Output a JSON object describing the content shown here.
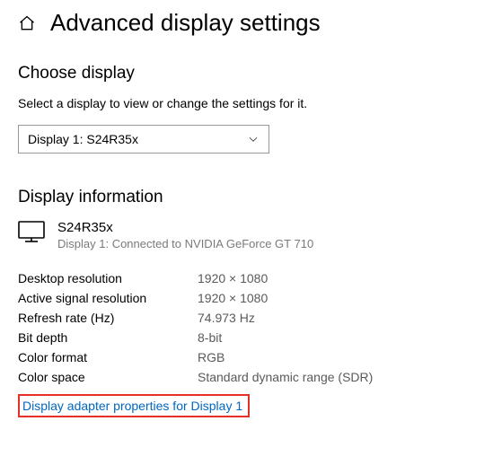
{
  "header": {
    "title": "Advanced display settings"
  },
  "choose": {
    "title": "Choose display",
    "instruction": "Select a display to view or change the settings for it.",
    "dropdownValue": "Display 1: S24R35x"
  },
  "info": {
    "title": "Display information",
    "monitorName": "S24R35x",
    "monitorSub": "Display 1: Connected to NVIDIA GeForce GT 710",
    "rows": [
      {
        "label": "Desktop resolution",
        "value": "1920 × 1080"
      },
      {
        "label": "Active signal resolution",
        "value": "1920 × 1080"
      },
      {
        "label": "Refresh rate (Hz)",
        "value": "74.973 Hz"
      },
      {
        "label": "Bit depth",
        "value": "8-bit"
      },
      {
        "label": "Color format",
        "value": "RGB"
      },
      {
        "label": "Color space",
        "value": "Standard dynamic range (SDR)"
      }
    ],
    "link": "Display adapter properties for Display 1"
  }
}
